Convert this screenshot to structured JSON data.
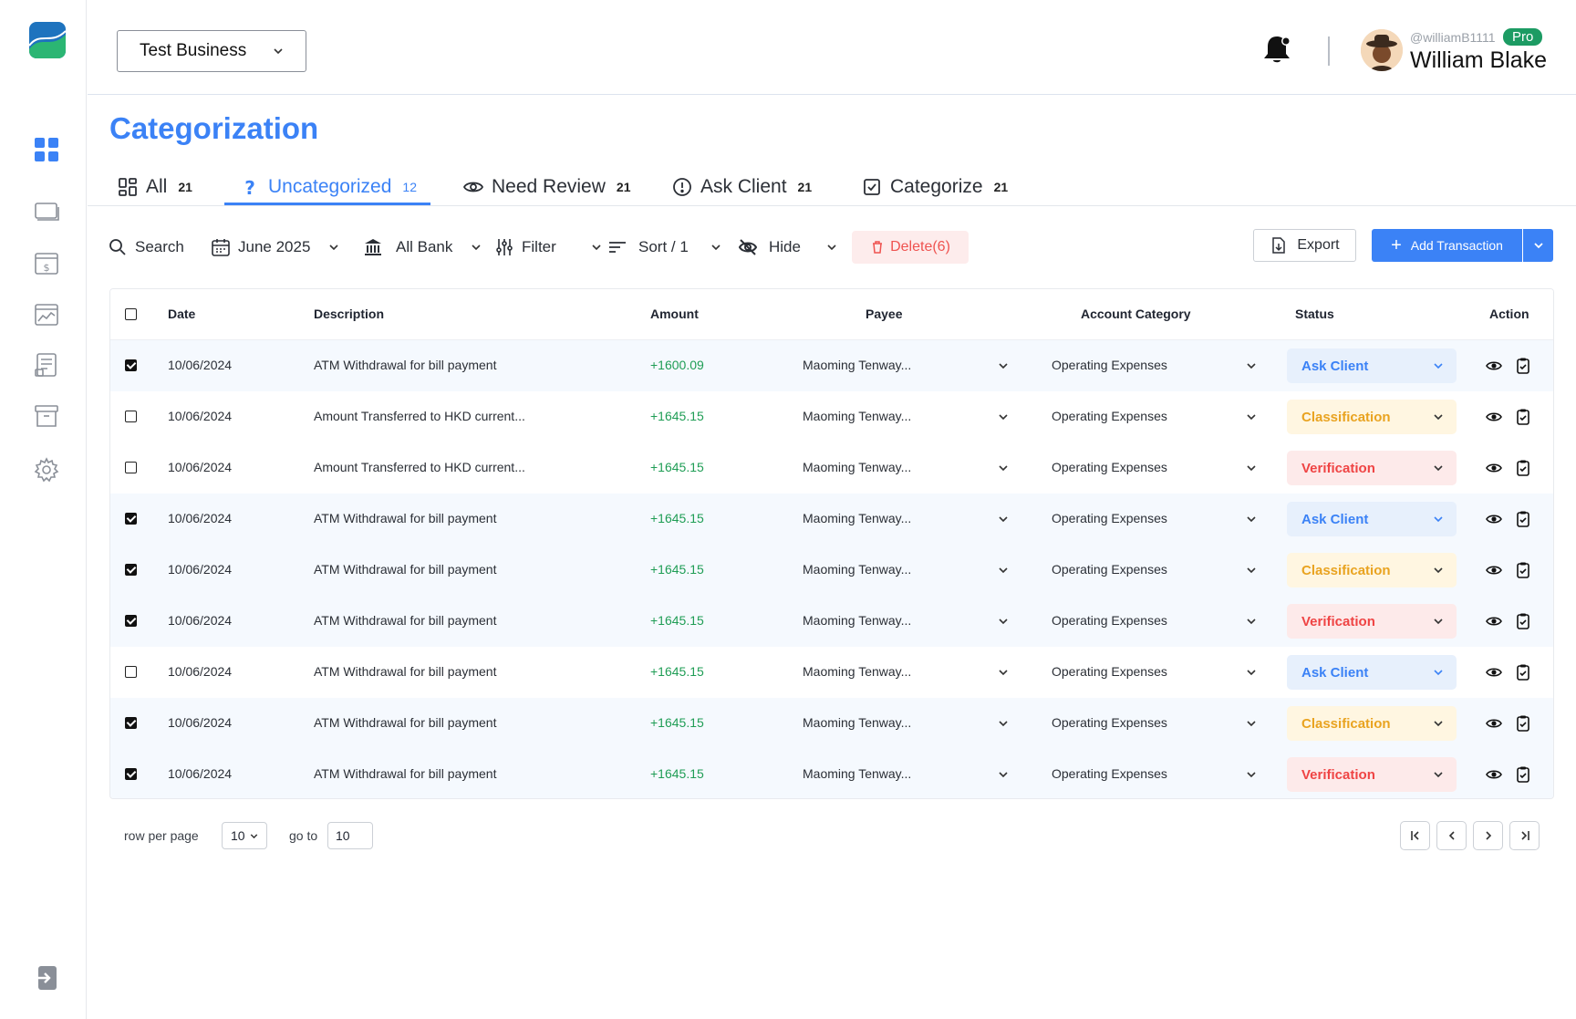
{
  "header": {
    "business": "Test Business",
    "user_handle": "@williamB1111",
    "user_badge": "Pro",
    "user_name": "William Blake"
  },
  "page_title": "Categorization",
  "tabs": [
    {
      "label": "All",
      "count": "21",
      "icon": "grid-icon",
      "active": false
    },
    {
      "label": "Uncategorized",
      "count": "12",
      "icon": "question-icon",
      "active": true
    },
    {
      "label": "Need Review",
      "count": "21",
      "icon": "eye-icon",
      "active": false
    },
    {
      "label": "Ask Client",
      "count": "21",
      "icon": "alert-circle-icon",
      "active": false
    },
    {
      "label": "Categorize",
      "count": "21",
      "icon": "checkbox-icon",
      "active": false
    }
  ],
  "toolbar": {
    "search": "Search",
    "date": "June 2025",
    "bank": "All Bank",
    "filter": "Filter",
    "sort": "Sort / 1",
    "hide": "Hide",
    "delete": "Delete(6)",
    "export": "Export",
    "add": "Add Transaction"
  },
  "table": {
    "headers": {
      "date": "Date",
      "description": "Description",
      "amount": "Amount",
      "payee": "Payee",
      "category": "Account Category",
      "status": "Status",
      "action": "Action"
    },
    "rows": [
      {
        "checked": true,
        "date": "10/06/2024",
        "description": "ATM Withdrawal for bill payment",
        "amount": "+1600.09",
        "payee": "Maoming Tenway...",
        "category": "Operating Expenses",
        "status": "Ask Client",
        "status_type": "ask"
      },
      {
        "checked": false,
        "date": "10/06/2024",
        "description": "Amount Transferred to HKD current...",
        "amount": "+1645.15",
        "payee": "Maoming Tenway...",
        "category": "Operating Expenses",
        "status": "Classification",
        "status_type": "class"
      },
      {
        "checked": false,
        "date": "10/06/2024",
        "description": "Amount Transferred to HKD current...",
        "amount": "+1645.15",
        "payee": "Maoming Tenway...",
        "category": "Operating Expenses",
        "status": "Verification",
        "status_type": "verif"
      },
      {
        "checked": true,
        "date": "10/06/2024",
        "description": "ATM Withdrawal for bill payment",
        "amount": "+1645.15",
        "payee": "Maoming Tenway...",
        "category": "Operating Expenses",
        "status": "Ask Client",
        "status_type": "ask"
      },
      {
        "checked": true,
        "date": "10/06/2024",
        "description": "ATM Withdrawal for bill payment",
        "amount": "+1645.15",
        "payee": "Maoming Tenway...",
        "category": "Operating Expenses",
        "status": "Classification",
        "status_type": "class"
      },
      {
        "checked": true,
        "date": "10/06/2024",
        "description": "ATM Withdrawal for bill payment",
        "amount": "+1645.15",
        "payee": "Maoming Tenway...",
        "category": "Operating Expenses",
        "status": "Verification",
        "status_type": "verif"
      },
      {
        "checked": false,
        "date": "10/06/2024",
        "description": "ATM Withdrawal for bill payment",
        "amount": "+1645.15",
        "payee": "Maoming Tenway...",
        "category": "Operating Expenses",
        "status": "Ask Client",
        "status_type": "ask"
      },
      {
        "checked": true,
        "date": "10/06/2024",
        "description": "ATM Withdrawal for bill payment",
        "amount": "+1645.15",
        "payee": "Maoming Tenway...",
        "category": "Operating Expenses",
        "status": "Classification",
        "status_type": "class"
      },
      {
        "checked": true,
        "date": "10/06/2024",
        "description": "ATM Withdrawal for bill payment",
        "amount": "+1645.15",
        "payee": "Maoming Tenway...",
        "category": "Operating Expenses",
        "status": "Verification",
        "status_type": "verif"
      }
    ]
  },
  "pagination": {
    "rows_label": "row per page",
    "rows_value": "10",
    "goto_label": "go to",
    "goto_value": "10"
  },
  "colors": {
    "accent": "#3b82f6",
    "positive": "#1f9d55",
    "ask_client": "#3b82f6",
    "classification": "#e9a320",
    "verification": "#ef4444"
  }
}
